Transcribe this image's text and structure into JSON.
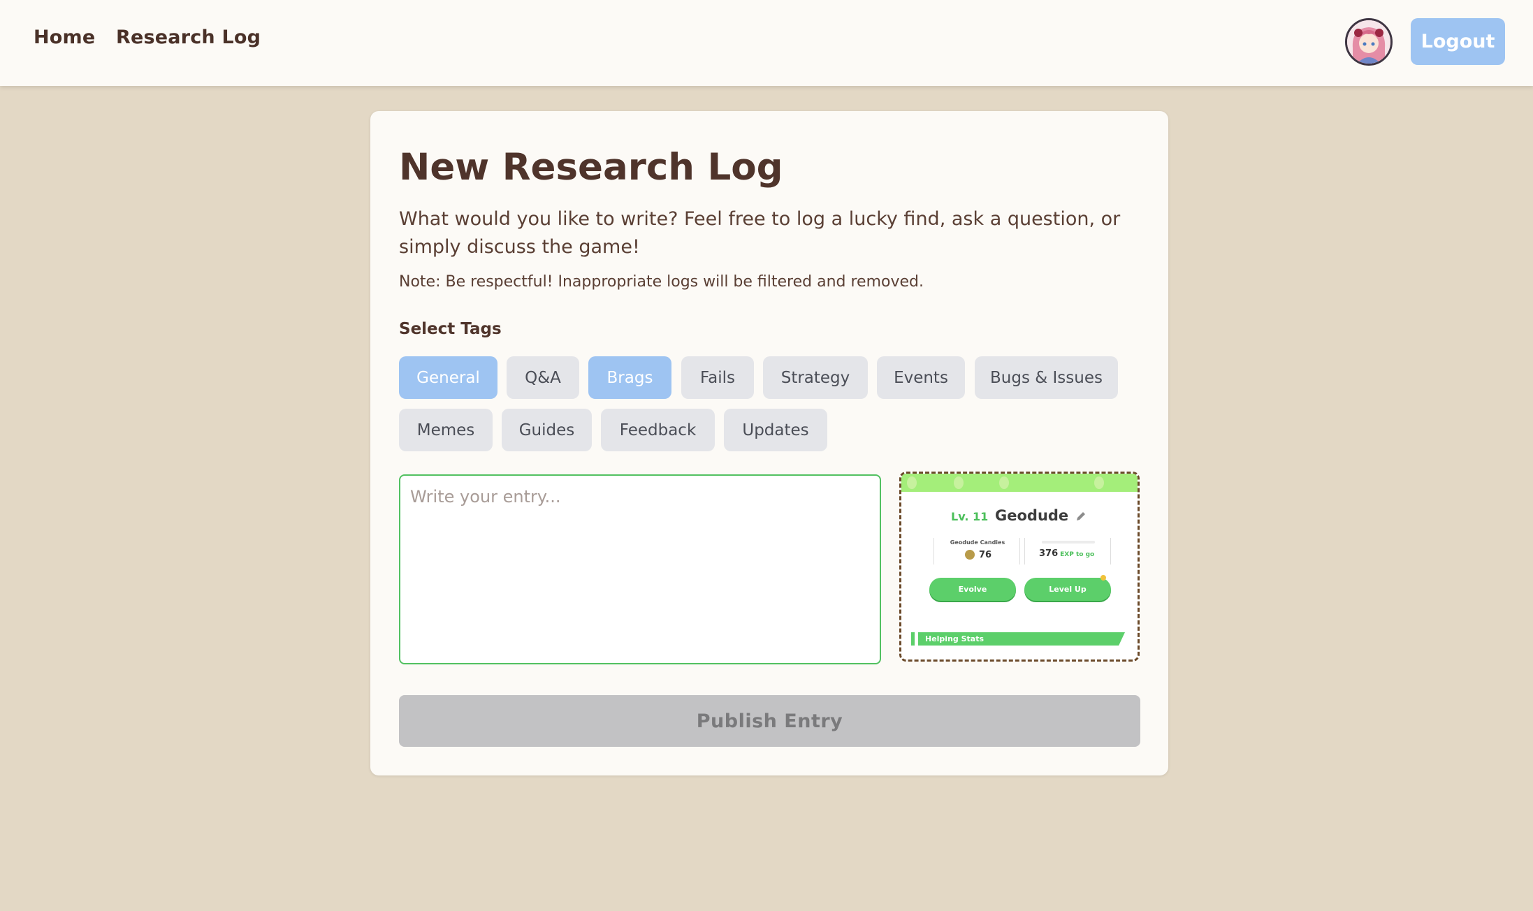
{
  "nav": {
    "home": "Home",
    "research_log": "Research Log",
    "logout": "Logout",
    "avatar_icon": "user-avatar"
  },
  "form": {
    "title": "New Research Log",
    "description": "What would you like to write? Feel free to log a lucky find, ask a question, or simply discuss the game!",
    "note": "Note: Be respectful! Inappropriate logs will be filtered and removed.",
    "tags_label": "Select Tags",
    "tags": [
      {
        "label": "General",
        "selected": true
      },
      {
        "label": "Q&A",
        "selected": false
      },
      {
        "label": "Brags",
        "selected": true
      },
      {
        "label": "Fails",
        "selected": false
      },
      {
        "label": "Strategy",
        "selected": false
      },
      {
        "label": "Events",
        "selected": false
      },
      {
        "label": "Bugs & Issues",
        "selected": false
      },
      {
        "label": "Memes",
        "selected": false
      },
      {
        "label": "Guides",
        "selected": false
      },
      {
        "label": "Feedback",
        "selected": false
      },
      {
        "label": "Updates",
        "selected": false
      }
    ],
    "entry_placeholder": "Write your entry...",
    "entry_value": "",
    "publish": "Publish Entry"
  },
  "preview": {
    "level": "Lv. 11",
    "name": "Geodude",
    "candies_label": "Geodude Candies",
    "candies": "76",
    "exp": "376",
    "exp_suffix": "EXP to go",
    "evolve": "Evolve",
    "level_up": "Level Up",
    "helping_stats": "Helping Stats"
  },
  "colors": {
    "background": "#e3d8c5",
    "accent_blue": "#9ec4f2",
    "accent_green": "#52c161",
    "text_brown": "#5a3f34"
  }
}
